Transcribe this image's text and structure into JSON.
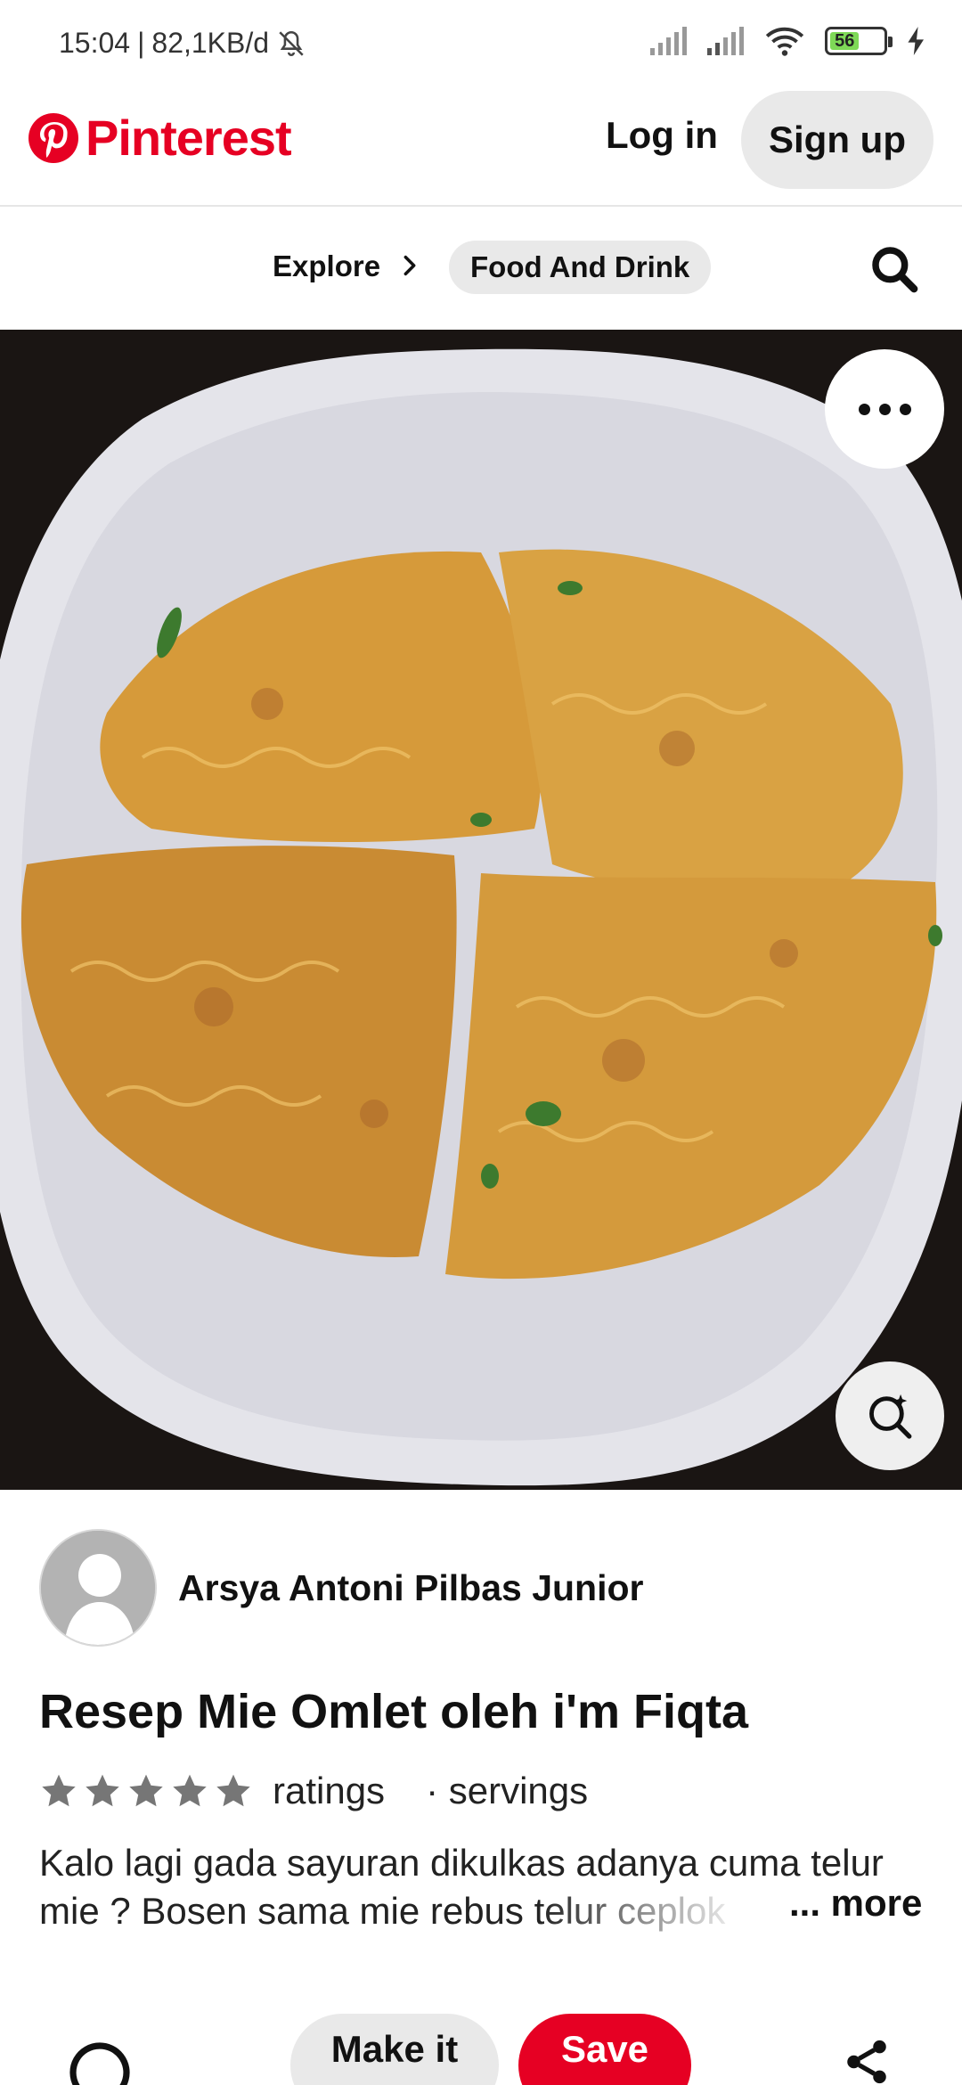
{
  "status_bar": {
    "time": "15:04",
    "network_speed": "82,1KB/d",
    "battery_level": "56",
    "icons": [
      "mute-icon",
      "signal-icon",
      "signal-icon",
      "wifi-icon",
      "battery-icon",
      "charging-icon"
    ]
  },
  "header": {
    "brand": "Pinterest",
    "login_label": "Log in",
    "signup_label": "Sign up",
    "brand_color": "#e60023"
  },
  "breadcrumb": {
    "root": "Explore",
    "current": "Food And Drink"
  },
  "pin": {
    "image_alt": "Mie omlet cut into four wedges on a white plate",
    "creator": "Arsya Antoni Pilbas Junior",
    "title": "Resep Mie Omlet oleh i'm Fiqta",
    "rating_stars": 5,
    "ratings_label": "ratings",
    "servings_label": "· servings",
    "description_line1": "Kalo lagi gada sayuran dikulkas adanya cuma telur",
    "description_line2": "mie ? Bosen sama mie rebus telur ceplok",
    "more_label": "... more"
  },
  "actions": {
    "make_it_label": "Make it",
    "save_label": "Save",
    "save_color": "#e60023"
  }
}
